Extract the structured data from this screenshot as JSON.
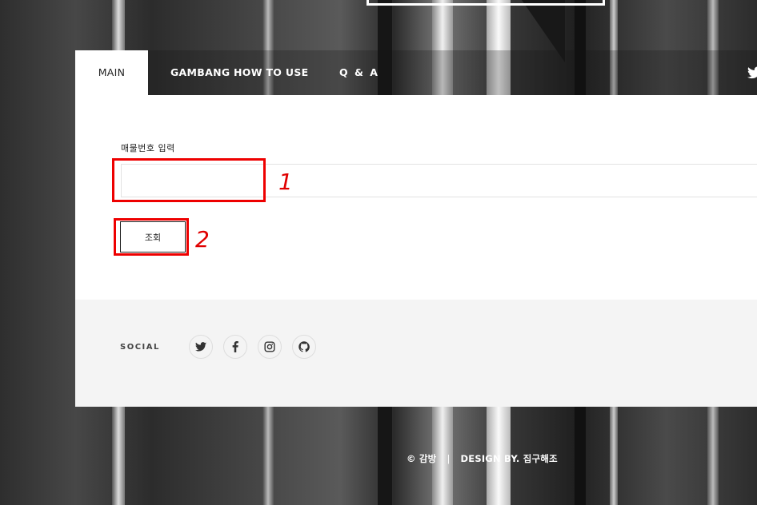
{
  "nav": {
    "tabs": [
      {
        "label": "MAIN",
        "active": true
      },
      {
        "label": "GAMBANG HOW TO USE",
        "active": false
      },
      {
        "label": "Q & A",
        "active": false
      }
    ],
    "social_icon": "twitter-icon"
  },
  "form": {
    "label": "매물번호 입력",
    "input_value": "",
    "input_placeholder": "",
    "submit_label": "조회"
  },
  "annotations": {
    "marker_1": "1",
    "marker_2": "2",
    "highlight_color": "#ee0000"
  },
  "social": {
    "label": "SOCIAL",
    "icons": [
      "twitter-icon",
      "facebook-icon",
      "instagram-icon",
      "github-icon"
    ]
  },
  "footer": {
    "copyright": "© 감방",
    "separator": "|",
    "credit": "DESIGN BY. 집구해조"
  }
}
